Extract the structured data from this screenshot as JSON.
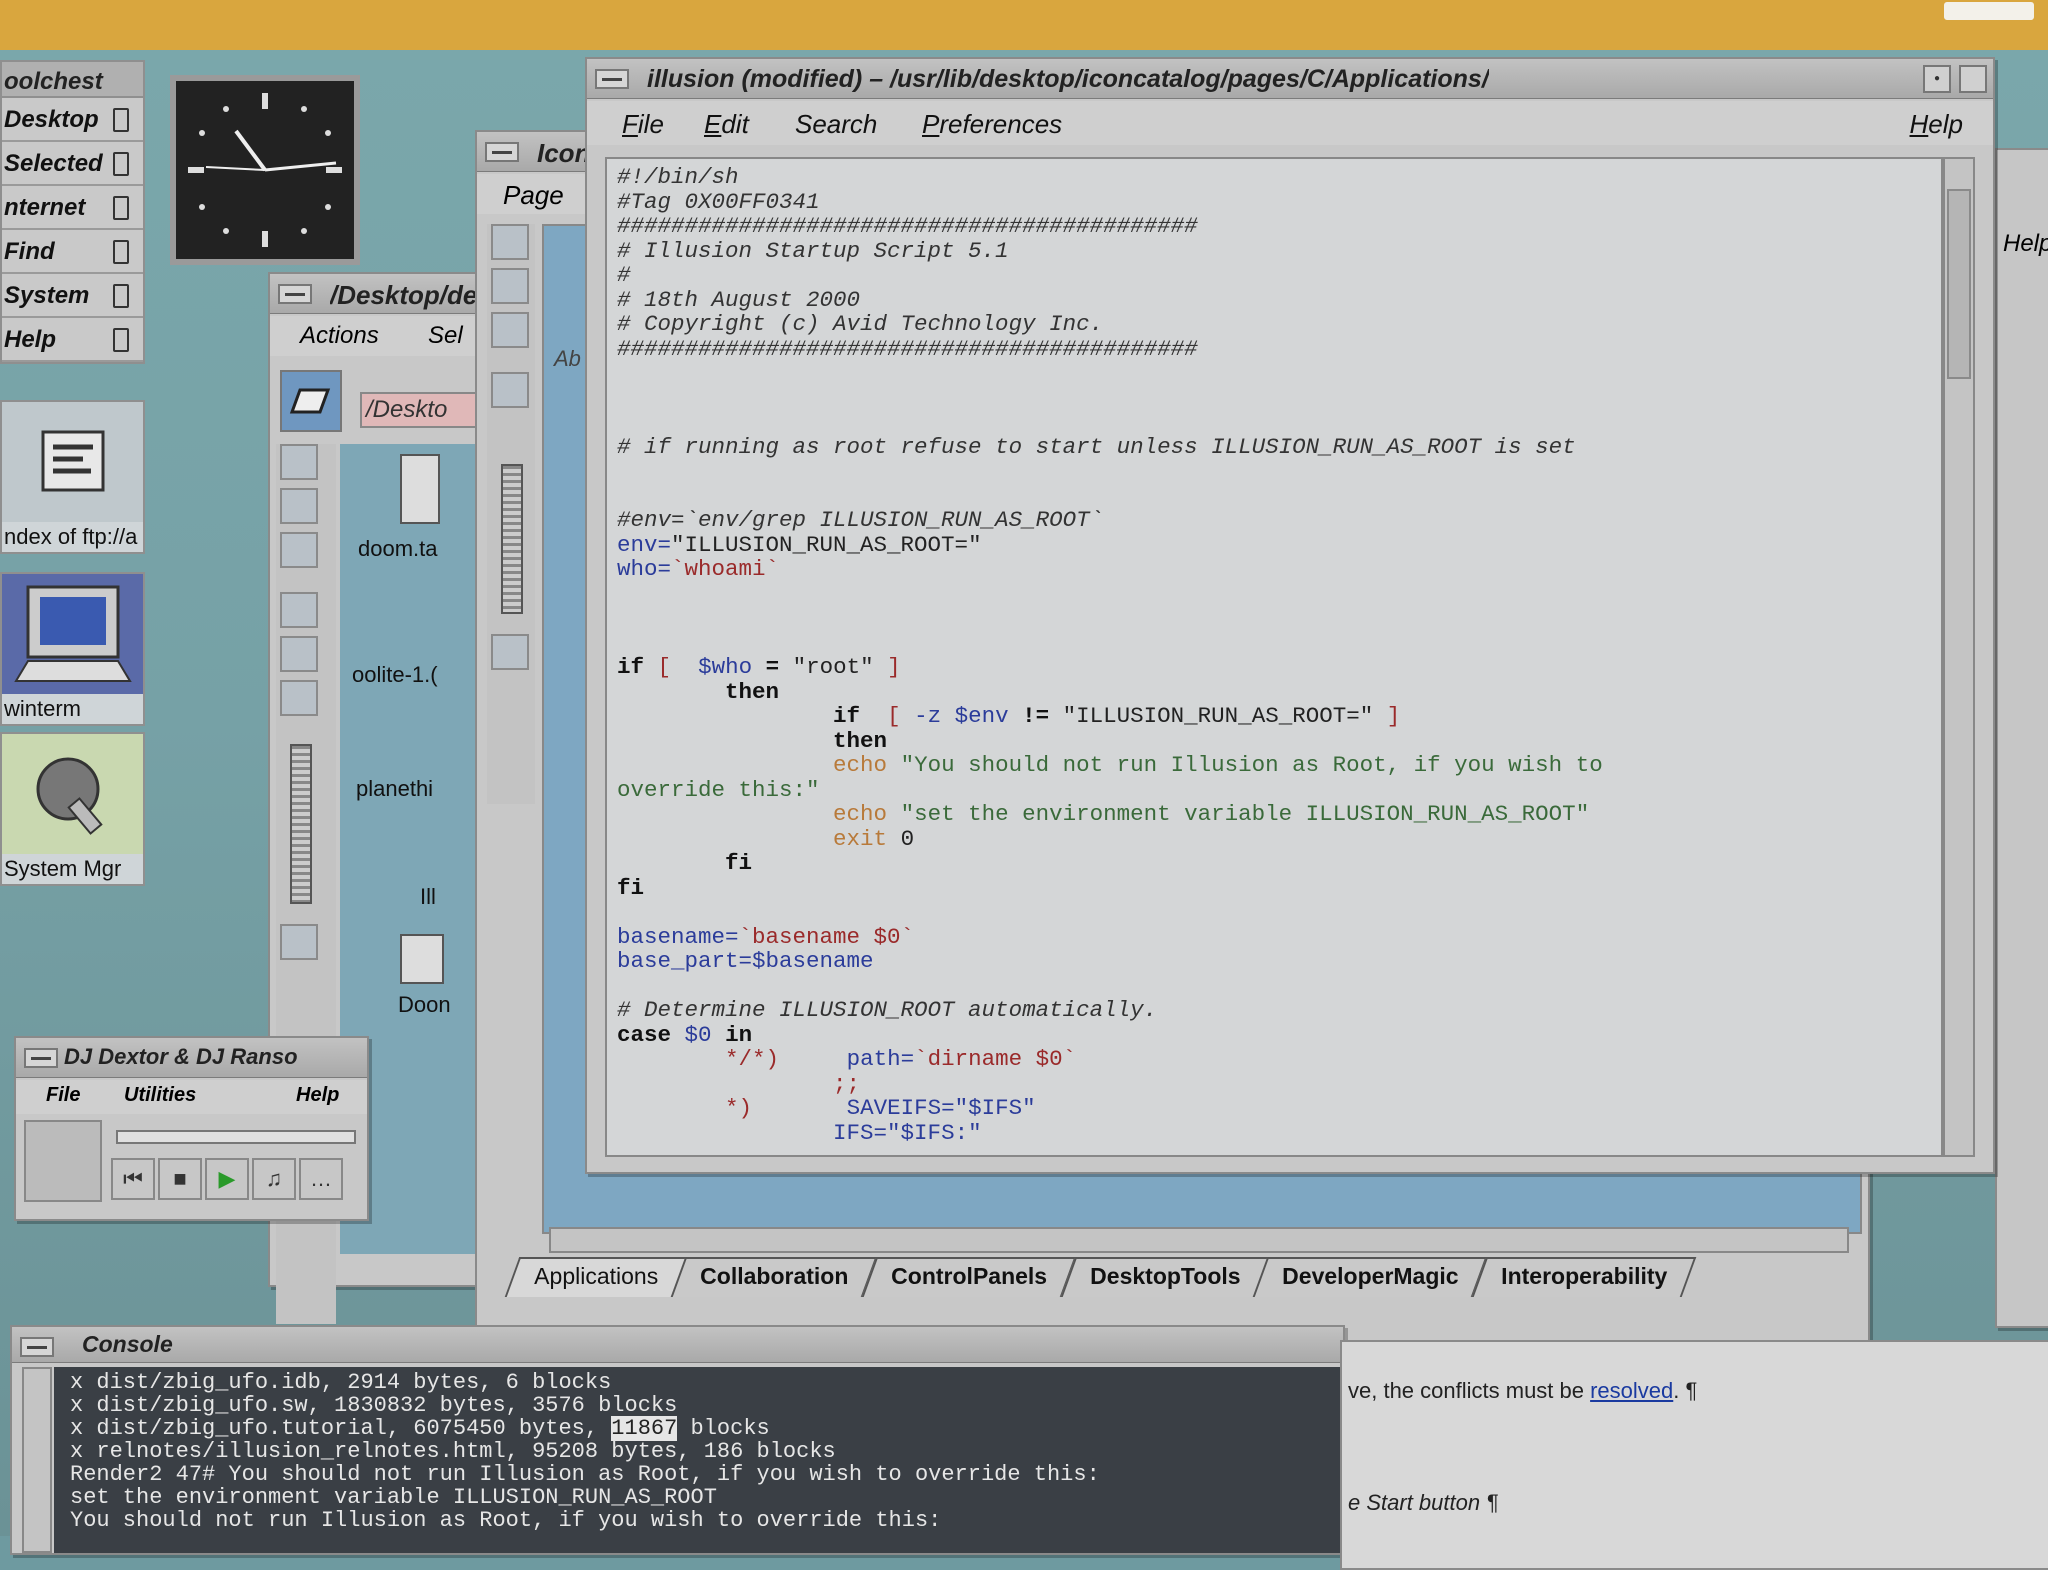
{
  "toolchest": {
    "title": "oolchest",
    "items": [
      {
        "label": "Desktop"
      },
      {
        "label": "Selected"
      },
      {
        "label": "nternet"
      },
      {
        "label": "Find"
      },
      {
        "label": "System"
      },
      {
        "label": "Help"
      }
    ]
  },
  "desktop_icons": [
    {
      "label": "ndex of ftp://a"
    },
    {
      "label": "winterm"
    },
    {
      "label": "System Mgr"
    }
  ],
  "editor": {
    "title": "illusion (modified) – /usr/lib/desktop/iconcatalog/pages/C/Applications/",
    "menu": {
      "file": "File",
      "edit": "Edit",
      "search": "Search",
      "preferences": "Preferences",
      "help": "Help"
    }
  },
  "catalog": {
    "title": "Icon",
    "menu_page": "Page",
    "pane_text": "Ab",
    "tabs": [
      {
        "label": "Applications"
      },
      {
        "label": "Collaboration"
      },
      {
        "label": "ControlPanels"
      },
      {
        "label": "DesktopTools"
      },
      {
        "label": "DeveloperMagic"
      },
      {
        "label": "Interoperability"
      }
    ]
  },
  "desktop_window": {
    "title": "/Desktop/de",
    "menu_actions": "Actions",
    "menu_sel": "Sel",
    "path": "/Deskto",
    "files": [
      {
        "label": "doom.ta"
      },
      {
        "label": "oolite-1.("
      },
      {
        "label": "planethi"
      },
      {
        "label": "Ill"
      },
      {
        "label": "Doon"
      }
    ]
  },
  "player": {
    "title": "DJ Dextor & DJ Ranso",
    "menu": {
      "file": "File",
      "utilities": "Utilities",
      "help": "Help"
    }
  },
  "console": {
    "title": "Console",
    "lines": [
      "x dist/zbig_ufo.idb, 2914 bytes, 6 blocks",
      "x dist/zbig_ufo.sw, 1830832 bytes, 3576 blocks",
      "x relnotes/illusion_relnotes.html, 95208 bytes, 186 blocks",
      "Render2 47# You should not run Illusion as Root, if you wish to override this:",
      "set the environment variable ILLUSION_RUN_AS_ROOT",
      "You should not run Illusion as Root, if you wish to override this:"
    ],
    "tutorial_line_prefix": "x dist/zbig_ufo.tutorial, 6075450 bytes, ",
    "tutorial_line_highlight": "11867",
    "tutorial_line_suffix": " blocks"
  },
  "helpdoc": {
    "line1_prefix": "ve, the conflicts must be ",
    "line1_link": "resolved",
    "line1_suffix": ". ¶",
    "line2": "e Start button ¶"
  },
  "rightwin": {
    "help": "Help"
  },
  "colors": {
    "desktop": "#76a1a6",
    "editor_bg": "#d4d6d7",
    "console_bg": "#3a3f45",
    "bezel": "#d9a63e"
  }
}
